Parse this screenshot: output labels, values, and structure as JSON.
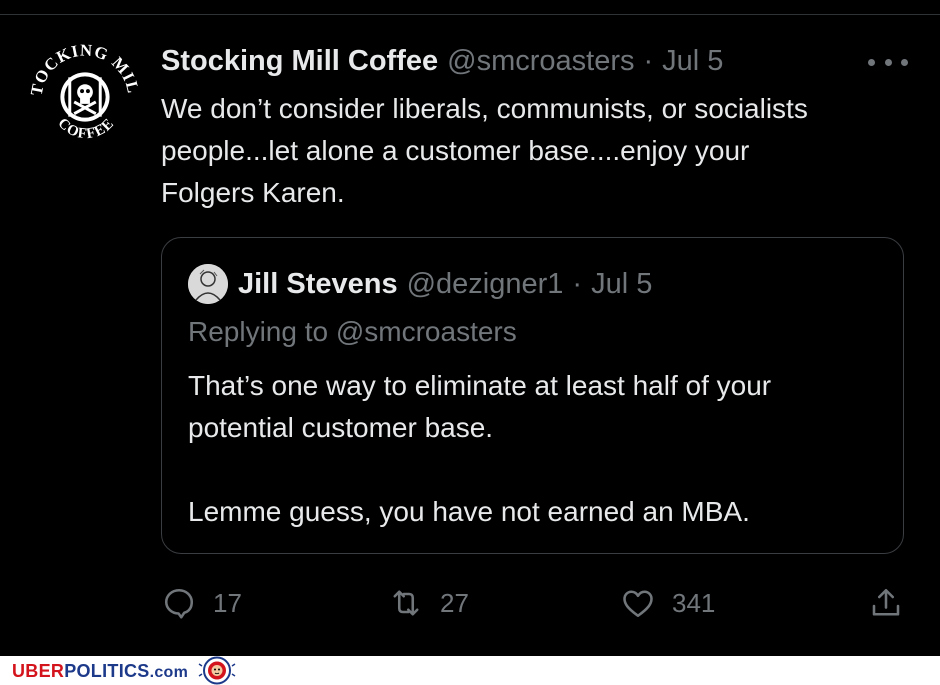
{
  "tweet": {
    "avatar_icon": "stocking-mill-coffee-logo",
    "avatar_text": {
      "top": "STOCKING MILL",
      "bottom": "COFFEE"
    },
    "author_name": "Stocking Mill Coffee",
    "handle": "@smcroasters",
    "separator": "·",
    "date": "Jul 5",
    "more_icon": "more-horizontal-icon",
    "text_lines": [
      "We don’t consider liberals, communists, or socialists",
      "people...let alone a customer base....enjoy your",
      "Folgers Karen."
    ]
  },
  "quote": {
    "avatar_icon": "user-avatar",
    "author_name": "Jill Stevens",
    "handle": "@dezigner1",
    "separator": "·",
    "date": "Jul 5",
    "replying_to": "Replying to @smcroasters",
    "text_lines": [
      "That’s one way to eliminate at least half of your",
      "potential customer base.",
      "",
      "Lemme guess, you have not earned an MBA."
    ]
  },
  "actions": {
    "reply": {
      "icon": "reply-icon",
      "count": "17"
    },
    "retweet": {
      "icon": "retweet-icon",
      "count": "27"
    },
    "like": {
      "icon": "like-icon",
      "count": "341"
    },
    "share": {
      "icon": "share-icon"
    }
  },
  "footer": {
    "brand_part1": "UBER",
    "brand_part2": "POLITICS",
    "brand_part3": ".com",
    "logo_icon": "lion-logo",
    "colors": {
      "red": "#d4141c",
      "blue": "#1d3a8a"
    }
  },
  "theme": {
    "background": "#000000",
    "text": "#e7e9ea",
    "muted": "#71767b",
    "border": "#3a3d41"
  }
}
